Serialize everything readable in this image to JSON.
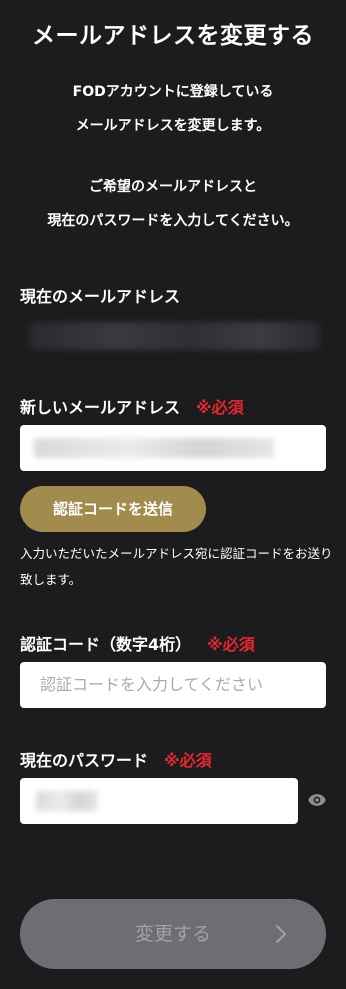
{
  "title": "メールアドレスを変更する",
  "intro": {
    "line1": "FODアカウントに登録している",
    "line2": "メールアドレスを変更します。",
    "line3": "ご希望のメールアドレスと",
    "line4": "現在のパスワードを入力してください。"
  },
  "current_email": {
    "label": "現在のメールアドレス"
  },
  "new_email": {
    "label": "新しいメールアドレス",
    "required": "※必須"
  },
  "send_code_button": "認証コードを送信",
  "send_note": "入力いただいたメールアドレス宛に認証コードをお送り致します。",
  "auth_code": {
    "label": "認証コード（数字4桁）",
    "required": "※必須",
    "placeholder": "認証コードを入力してください"
  },
  "password": {
    "label": "現在のパスワード",
    "required": "※必須"
  },
  "submit_button": "変更する",
  "colors": {
    "background": "#1c1c1f",
    "required": "#e8262d",
    "send_button": "#a18c4d",
    "submit_button_disabled": "#6e6e72"
  },
  "icons": {
    "password_toggle": "eye-icon",
    "submit_arrow": "chevron-right-icon"
  }
}
